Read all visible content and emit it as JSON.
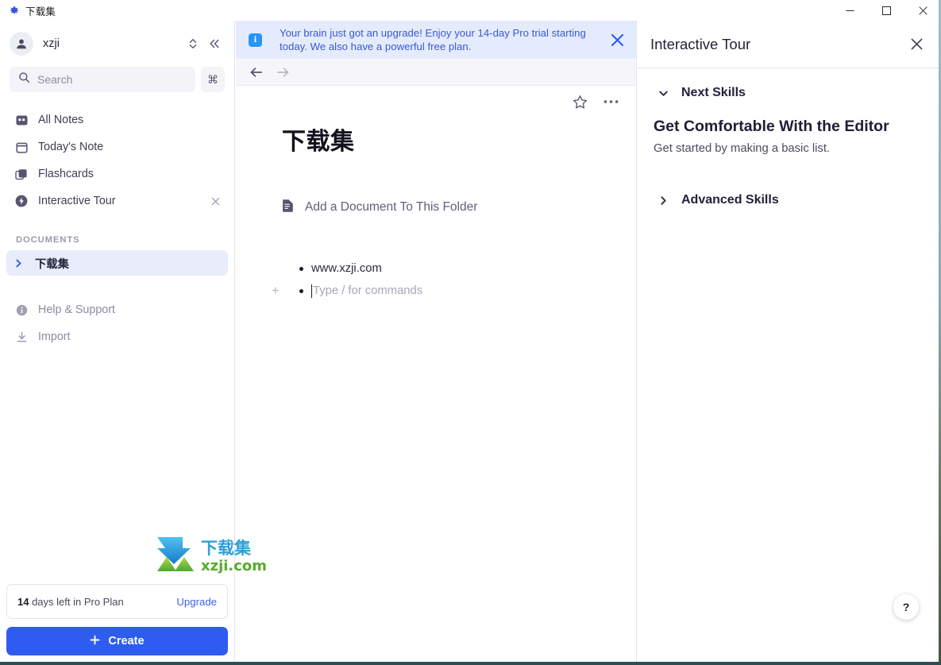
{
  "window": {
    "title": "下载集",
    "app_icon": "app-logo-icon",
    "controls": {
      "minimize": "minimize-icon",
      "maximize": "maximize-icon",
      "close": "close-icon"
    }
  },
  "sidebar": {
    "user": {
      "name": "xzji",
      "avatar_icon": "user-avatar-icon",
      "switch_icon": "chevron-up-down-icon",
      "collapse_icon": "collapse-sidebar-icon"
    },
    "search": {
      "placeholder": "Search",
      "icon": "search-icon",
      "shortcut": "⌘"
    },
    "nav": [
      {
        "label": "All Notes",
        "icon": "grid-icon"
      },
      {
        "label": "Today's Note",
        "icon": "calendar-icon"
      },
      {
        "label": "Flashcards",
        "icon": "flashcards-icon"
      },
      {
        "label": "Interactive Tour",
        "icon": "lightning-icon",
        "close_icon": "close-small-icon"
      }
    ],
    "documents_section": {
      "title": "DOCUMENTS",
      "items": [
        {
          "label": "下载集",
          "caret_icon": "chevron-right-icon",
          "selected": true
        }
      ]
    },
    "bottom_nav": [
      {
        "label": "Help & Support",
        "icon": "info-circle-icon"
      },
      {
        "label": "Import",
        "icon": "download-icon"
      }
    ],
    "plan": {
      "days": "14",
      "text": " days left in Pro Plan",
      "upgrade_label": "Upgrade"
    },
    "create_button": {
      "label": "Create",
      "plus_icon": "plus-icon"
    },
    "watermark": {
      "line1": "下载集",
      "line2": "xzji.com"
    }
  },
  "editor": {
    "banner": {
      "icon": "info-square-icon",
      "message": "Your brain just got an upgrade! Enjoy your 14-day Pro trial starting today. We also have a powerful free plan.",
      "close_icon": "close-icon"
    },
    "navigation": {
      "back_icon": "arrow-left-icon",
      "forward_icon": "arrow-right-icon"
    },
    "toolbar": {
      "favorite_icon": "star-icon",
      "more_icon": "ellipsis-icon"
    },
    "document": {
      "title": "下载集",
      "add_document_label": "Add a Document To This Folder",
      "add_document_icon": "document-icon",
      "list_items": [
        {
          "text": "www.xzji.com",
          "is_placeholder": false
        },
        {
          "text": "Type / for commands",
          "is_placeholder": true
        }
      ],
      "block_handle_icon": "plus-icon"
    }
  },
  "right_panel": {
    "title": "Interactive Tour",
    "close_icon": "close-icon",
    "groups": [
      {
        "label": "Next Skills",
        "caret_icon": "chevron-down-icon",
        "expanded": true,
        "card": {
          "heading": "Get Comfortable With the Editor",
          "description": "Get started by making a basic list."
        }
      },
      {
        "label": "Advanced Skills",
        "caret_icon": "chevron-right-icon",
        "expanded": false
      }
    ],
    "help_fab": "?"
  },
  "colors": {
    "accent": "#2f5cf0",
    "banner_bg": "#e4ebfd",
    "banner_text": "#3959d9",
    "selected_item_bg": "#e8ecfb"
  }
}
